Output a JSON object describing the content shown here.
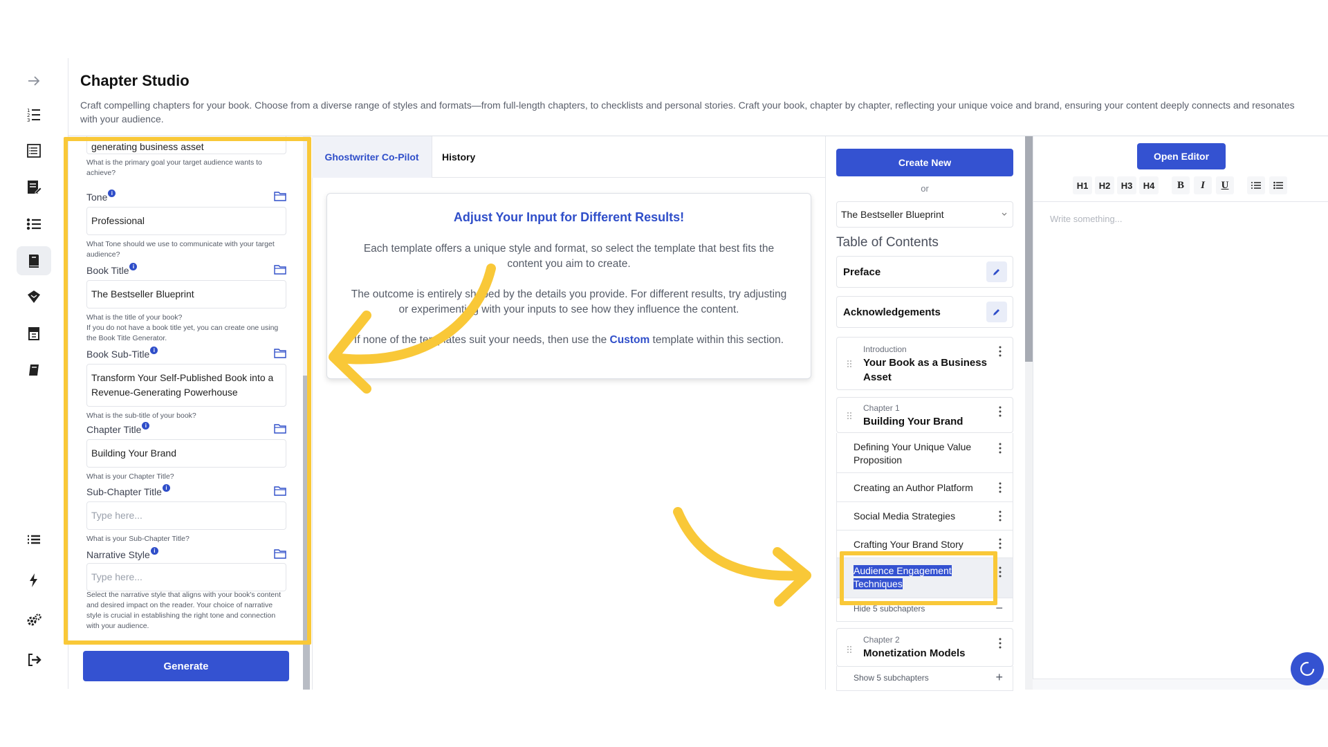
{
  "colors": {
    "accent": "#3452d1",
    "highlight": "#f9c838",
    "text_muted": "#5a5f6b"
  },
  "header": {
    "title": "Chapter Studio",
    "description": "Craft compelling chapters for your book. Choose from a diverse range of styles and formats—from full-length chapters, to checklists and personal stories. Craft your book, chapter by chapter, reflecting your unique voice and brand, ensuring your content deeply connects and resonates with your audience."
  },
  "rail": {
    "icons": [
      "arrow-right-icon",
      "numbered-list-icon",
      "document-list-icon",
      "edit-document-icon",
      "bullet-list-icon",
      "book-open-icon",
      "tag-icon",
      "archive-icon",
      "book-icon",
      "list-icon",
      "bolt-icon",
      "settings-icon",
      "logout-icon"
    ]
  },
  "form": {
    "goal": {
      "value": "generating business asset",
      "helper": "What is the primary goal your target audience wants to achieve?"
    },
    "tone": {
      "label": "Tone",
      "value": "Professional",
      "helper": "What Tone should we use to communicate with your target audience?"
    },
    "book_title": {
      "label": "Book Title",
      "value": "The Bestseller Blueprint",
      "helper": "What is the title of your book?\nIf you do not have a book title yet, you can create one using the Book Title Generator."
    },
    "book_subtitle": {
      "label": "Book Sub-Title",
      "value": "Transform Your Self-Published Book into a Revenue-Generating Powerhouse",
      "helper": "What is the sub-title of your book?"
    },
    "chapter_title": {
      "label": "Chapter Title",
      "value": "Building Your Brand",
      "helper": "What is your Chapter Title?"
    },
    "subchapter_title": {
      "label": "Sub-Chapter Title",
      "placeholder": "Type here...",
      "helper": "What is your Sub-Chapter Title?"
    },
    "narrative_style": {
      "label": "Narrative Style",
      "placeholder": "Type here...",
      "helper": "Select the narrative style that aligns with your book's content and desired impact on the reader. Your choice of narrative style is crucial in establishing the right tone and connection with your audience."
    },
    "generate_label": "Generate"
  },
  "tabs": {
    "copilot": "Ghostwriter Co-Pilot",
    "history": "History"
  },
  "tip": {
    "title": "Adjust Your Input for Different Results!",
    "p1": "Each template offers a unique style and format, so select the template that best fits the content you aim to create.",
    "p2": "The outcome is entirely shaped by the details you provide. For different results, try adjusting or experimenting with your inputs to see how they influence the content.",
    "p3_before": "If none of the templates suit your needs, then use the ",
    "p3_link": "Custom",
    "p3_after": " template within this section."
  },
  "toc": {
    "create_label": "Create New",
    "or_label": "or",
    "selected_book": "The Bestseller Blueprint",
    "heading": "Table of Contents",
    "preface": "Preface",
    "acknowledgements": "Acknowledgements",
    "intro": {
      "label": "Introduction",
      "title": "Your Book as a Business Asset"
    },
    "chapter1": {
      "label": "Chapter 1",
      "title": "Building Your Brand",
      "subchapters": [
        "Defining Your Unique Value Proposition",
        "Creating an Author Platform",
        "Social Media Strategies",
        "Crafting Your Brand Story",
        "Audience Engagement Techniques"
      ],
      "toggle": "Hide 5 subchapters"
    },
    "chapter2": {
      "label": "Chapter 2",
      "title": "Monetization Models",
      "toggle": "Show 5 subchapters"
    }
  },
  "editor": {
    "open_label": "Open Editor",
    "toolbar": [
      "H1",
      "H2",
      "H3",
      "H4",
      "B",
      "I",
      "U"
    ],
    "placeholder": "Write something..."
  }
}
